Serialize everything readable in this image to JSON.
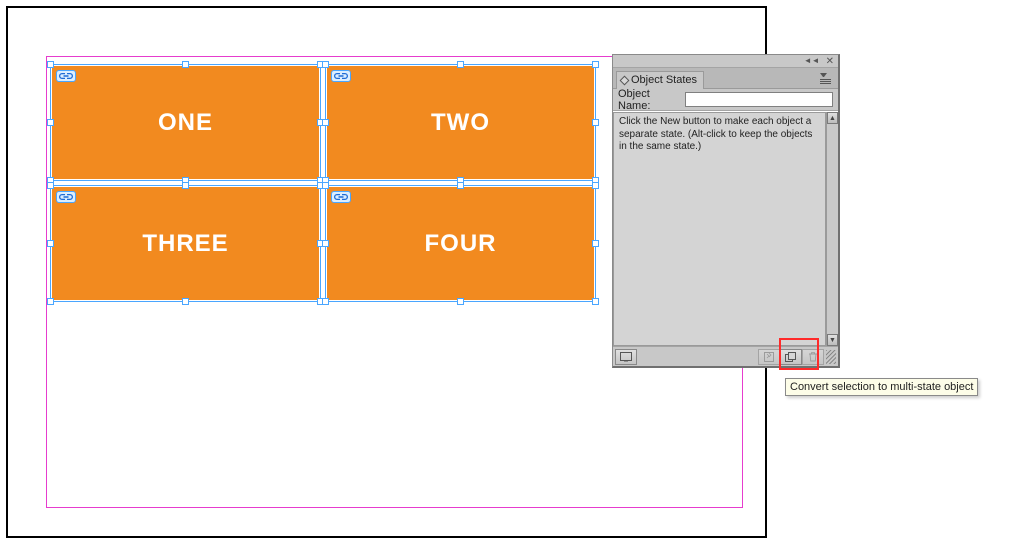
{
  "canvas": {
    "objects": [
      {
        "label": "ONE"
      },
      {
        "label": "TWO"
      },
      {
        "label": "THREE"
      },
      {
        "label": "FOUR"
      }
    ]
  },
  "panel": {
    "title": "Object States",
    "object_name_label": "Object Name:",
    "object_name_value": "",
    "hint_text": "Click the New button to make each object a separate state. (Alt-click to keep the objects in the same state.)"
  },
  "tooltip": {
    "text": "Convert selection to multi-state object"
  },
  "colors": {
    "accent_orange": "#f28a1f",
    "selection_blue": "#4aa6ff",
    "margin_magenta": "#e63cce",
    "highlight_red": "#ff2a2a"
  }
}
